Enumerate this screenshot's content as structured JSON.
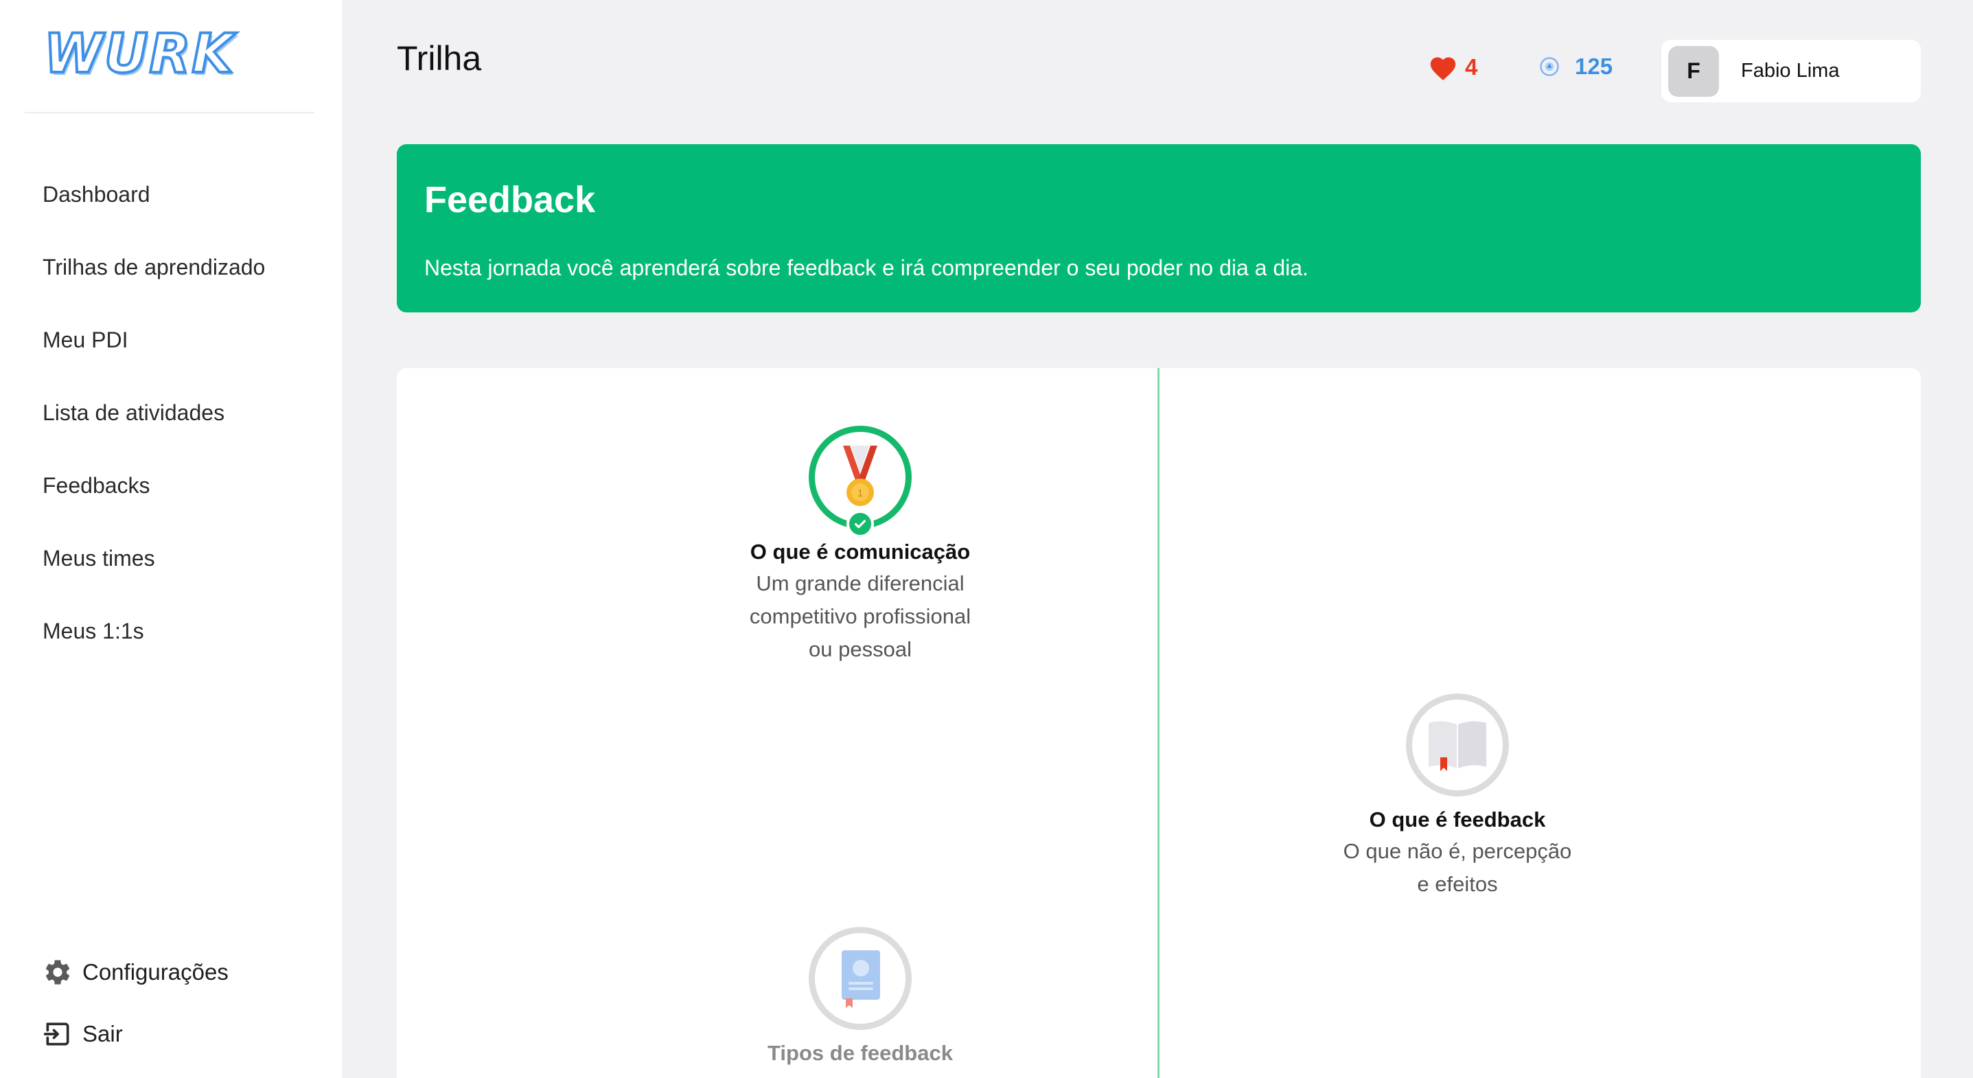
{
  "brand": {
    "logo_text": "WURK"
  },
  "sidebar": {
    "items": [
      {
        "label": "Dashboard"
      },
      {
        "label": "Trilhas de aprendizado"
      },
      {
        "label": "Meu PDI"
      },
      {
        "label": "Lista de atividades"
      },
      {
        "label": "Feedbacks"
      },
      {
        "label": "Meus times"
      },
      {
        "label": "Meus 1:1s"
      }
    ],
    "settings_label": "Configurações",
    "logout_label": "Sair"
  },
  "header": {
    "title": "Trilha",
    "hearts": "4",
    "points": "125",
    "user": {
      "initial": "F",
      "name": "Fabio Lima"
    }
  },
  "banner": {
    "title": "Feedback",
    "description": "Nesta jornada você aprenderá sobre feedback e irá compreender o seu poder no dia a dia."
  },
  "track": {
    "steps": [
      {
        "title": "O que é comunicação",
        "subtitle_lines": [
          "Um grande diferencial",
          "competitivo profissional",
          "ou pessoal"
        ],
        "status": "completed",
        "icon": "medal-icon"
      },
      {
        "title": "O que é feedback",
        "subtitle_lines": [
          "O que não é, percepção",
          "e efeitos"
        ],
        "status": "locked",
        "icon": "book-icon"
      },
      {
        "title": "Tipos de feedback",
        "subtitle_lines": [],
        "status": "locked",
        "icon": "document-icon"
      }
    ]
  },
  "colors": {
    "accent_green": "#02ba75",
    "heart_red": "#e8381e",
    "points_blue": "#3d8fe0"
  }
}
